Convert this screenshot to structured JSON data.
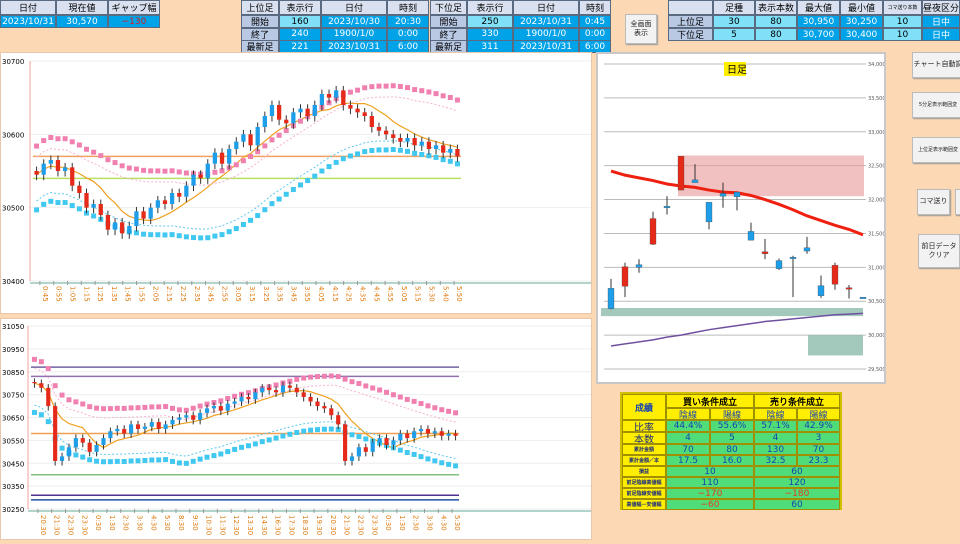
{
  "top_left": {
    "headers": [
      "日付",
      "現在値",
      "ギャップ幅"
    ],
    "values": [
      "2023/10/31",
      "30,570",
      "−130"
    ]
  },
  "upper_table": {
    "headers": [
      "上位足",
      "表示行",
      "日付",
      "時刻"
    ],
    "rows": [
      [
        "開始",
        "160",
        "2023/10/30",
        "20:30"
      ],
      [
        "終了",
        "240",
        "1900/1/0",
        "0:00"
      ],
      [
        "最新足",
        "221",
        "2023/10/31",
        "6:00"
      ]
    ]
  },
  "lower_table": {
    "headers": [
      "下位足",
      "表示行",
      "日付",
      "時刻"
    ],
    "rows": [
      [
        "開始",
        "250",
        "2023/10/31",
        "0:45"
      ],
      [
        "終了",
        "330",
        "1900/1/0",
        "0:00"
      ],
      [
        "最新足",
        "311",
        "2023/10/31",
        "6:00"
      ]
    ]
  },
  "fullscreen_button": "全画面\n表示",
  "settings_table": {
    "headers": [
      "",
      "足種",
      "表示本数",
      "最大値",
      "最小値",
      "コマ送り本数",
      "昼夜区分"
    ],
    "rows": [
      [
        "上位足",
        "30",
        "80",
        "30,950",
        "30,250",
        "10",
        "日中"
      ],
      [
        "下位足",
        "5",
        "80",
        "30,700",
        "30,400",
        "10",
        "日中"
      ]
    ]
  },
  "side_buttons": [
    "チャート自動調",
    "5分足表示範囲変",
    "上位足表示範囲変",
    "コマ送り",
    "",
    "前日データ\nクリア"
  ],
  "results": {
    "title": "成績",
    "buy": "買い条件成立",
    "sell": "売り条件成立",
    "sub": [
      "陰線",
      "陽線",
      "陰線",
      "陽線"
    ],
    "rows": [
      {
        "label": "比率",
        "vals": [
          "44.4%",
          "55.6%",
          "57.1%",
          "42.9%"
        ]
      },
      {
        "label": "本数",
        "vals": [
          "4",
          "5",
          "4",
          "3"
        ]
      },
      {
        "label": "累計金額",
        "vals": [
          "70",
          "80",
          "130",
          "70"
        ]
      },
      {
        "label": "累計金額／本",
        "vals": [
          "17.5",
          "16.0",
          "32.5",
          "23.3"
        ]
      }
    ],
    "merged": [
      {
        "label": "損益",
        "vals": [
          "10",
          "60"
        ]
      },
      {
        "label": "前足陰線高値幅",
        "vals": [
          "110",
          "120"
        ]
      },
      {
        "label": "前足陰線安値幅",
        "vals": [
          "−170",
          "−180"
        ]
      },
      {
        "label": "高値幅－安値幅",
        "vals": [
          "−60",
          "60"
        ]
      }
    ]
  },
  "colors": {
    "up": "#1e9ee8",
    "down": "#e62a1a",
    "pink": "#f080b0",
    "cyan": "#40c8f0",
    "time": "#e07a10"
  },
  "chart_data": [
    {
      "type": "candlestick",
      "name": "5min",
      "yticks": [
        "30700",
        "30600",
        "30500",
        "30400"
      ],
      "ylim": [
        30400,
        30700
      ],
      "xlabels": [
        "0:45",
        "0:55",
        "1:05",
        "1:15",
        "1:25",
        "1:35",
        "1:45",
        "1:55",
        "2:05",
        "2:15",
        "2:25",
        "2:35",
        "2:45",
        "2:55",
        "3:05",
        "3:15",
        "3:25",
        "3:35",
        "3:45",
        "3:55",
        "4:05",
        "4:15",
        "4:25",
        "4:35",
        "4:45",
        "4:55",
        "5:05",
        "5:15",
        "5:30",
        "5:40",
        "5:50"
      ],
      "close": [
        30545,
        30560,
        30565,
        30550,
        30555,
        30530,
        30520,
        30500,
        30505,
        30490,
        30470,
        30480,
        30465,
        30475,
        30495,
        30485,
        30500,
        30510,
        30505,
        30520,
        30515,
        30530,
        30545,
        30540,
        30560,
        30575,
        30560,
        30580,
        30590,
        30600,
        30585,
        30610,
        30625,
        30640,
        30620,
        30615,
        30630,
        30635,
        30625,
        30640,
        30655,
        30650,
        30660,
        30640,
        30635,
        30630,
        30625,
        30610,
        30605,
        30600,
        30595,
        30590,
        30595,
        30585,
        30590,
        30580,
        30585,
        30575,
        30580,
        30570
      ],
      "levels": [
        {
          "price": 30570,
          "color": "#f0a060"
        },
        {
          "price": 30540,
          "color": "#b8e060"
        }
      ]
    },
    {
      "type": "candlestick",
      "name": "30min",
      "yticks": [
        "31050",
        "30950",
        "30850",
        "30750",
        "30650",
        "30550",
        "30450",
        "30350",
        "30250"
      ],
      "ylim": [
        30250,
        31050
      ],
      "xlabels": [
        "20:30",
        "21:30",
        "22:30",
        "23:30",
        "0:30",
        "1:30",
        "2:30",
        "3:30",
        "4:30",
        "5:30",
        "8:30",
        "9:30",
        "10:30",
        "11:30",
        "12:30",
        "13:30",
        "14:30",
        "16:30",
        "17:30",
        "18:30",
        "19:30",
        "20:30",
        "21:30",
        "22:30",
        "23:30",
        "0:30",
        "1:30",
        "2:30",
        "3:30",
        "4:30",
        "5:30"
      ],
      "close": [
        30800,
        30780,
        30700,
        30460,
        30480,
        30520,
        30560,
        30540,
        30500,
        30530,
        30560,
        30590,
        30600,
        30580,
        30620,
        30600,
        30610,
        30630,
        30600,
        30620,
        30640,
        30650,
        30660,
        30640,
        30670,
        30690,
        30700,
        30680,
        30710,
        30720,
        30740,
        30730,
        30760,
        30780,
        30770,
        30760,
        30790,
        30780,
        30760,
        30740,
        30720,
        30700,
        30690,
        30660,
        30620,
        30460,
        30480,
        30520,
        30500,
        30540,
        30560,
        30530,
        30550,
        30580,
        30560,
        30590,
        30600,
        30580,
        30590,
        30570,
        30580,
        30570
      ],
      "levels": [
        {
          "price": 30870,
          "color": "#7060a0"
        },
        {
          "price": 30830,
          "color": "#9070b0"
        },
        {
          "price": 30580,
          "color": "#f0a050"
        },
        {
          "price": 30400,
          "color": "#80c080"
        },
        {
          "price": 30310,
          "color": "#503090"
        },
        {
          "price": 30290,
          "color": "#2050a0"
        }
      ]
    },
    {
      "type": "candlestick",
      "name": "daily",
      "title": "日足",
      "yticks": [
        "34,000",
        "33,500",
        "33,000",
        "32,500",
        "32,000",
        "31,500",
        "31,000",
        "30,500",
        "30,000",
        "29,500"
      ],
      "ylim": [
        29500,
        34000
      ],
      "ohlc": [
        [
          30390,
          30830,
          30380,
          30690
        ],
        [
          31010,
          31070,
          30560,
          30720
        ],
        [
          31000,
          31120,
          30920,
          31040
        ],
        [
          31720,
          31820,
          31330,
          31340
        ],
        [
          31900,
          32050,
          31780,
          31900
        ],
        [
          32640,
          32640,
          32140,
          32140
        ],
        [
          32250,
          32520,
          32250,
          32290
        ],
        [
          31670,
          31960,
          31560,
          31960
        ],
        [
          32050,
          32250,
          31880,
          32090
        ],
        [
          32040,
          32100,
          31840,
          32110
        ],
        [
          31400,
          31660,
          31400,
          31530
        ],
        [
          31230,
          31420,
          31120,
          31200
        ],
        [
          30980,
          31130,
          30960,
          31100
        ],
        [
          31150,
          31170,
          30560,
          31150
        ],
        [
          31240,
          31450,
          31200,
          31290
        ],
        [
          30580,
          30880,
          30550,
          30730
        ],
        [
          31030,
          31070,
          30670,
          30750
        ],
        [
          30700,
          30740,
          30540,
          30680
        ],
        [
          30560,
          30560,
          30560,
          30560
        ]
      ],
      "ma_red": [
        32420,
        32360,
        32320,
        32280,
        32230,
        32200,
        32180,
        32140,
        32110,
        32100,
        32060,
        32000,
        31930,
        31850,
        31760,
        31690,
        31620,
        31560,
        31480
      ],
      "ma_purple": [
        29840,
        29870,
        29900,
        29930,
        29970,
        30000,
        30040,
        30080,
        30110,
        30140,
        30170,
        30200,
        30220,
        30240,
        30260,
        30280,
        30300,
        30310,
        30320
      ]
    }
  ]
}
